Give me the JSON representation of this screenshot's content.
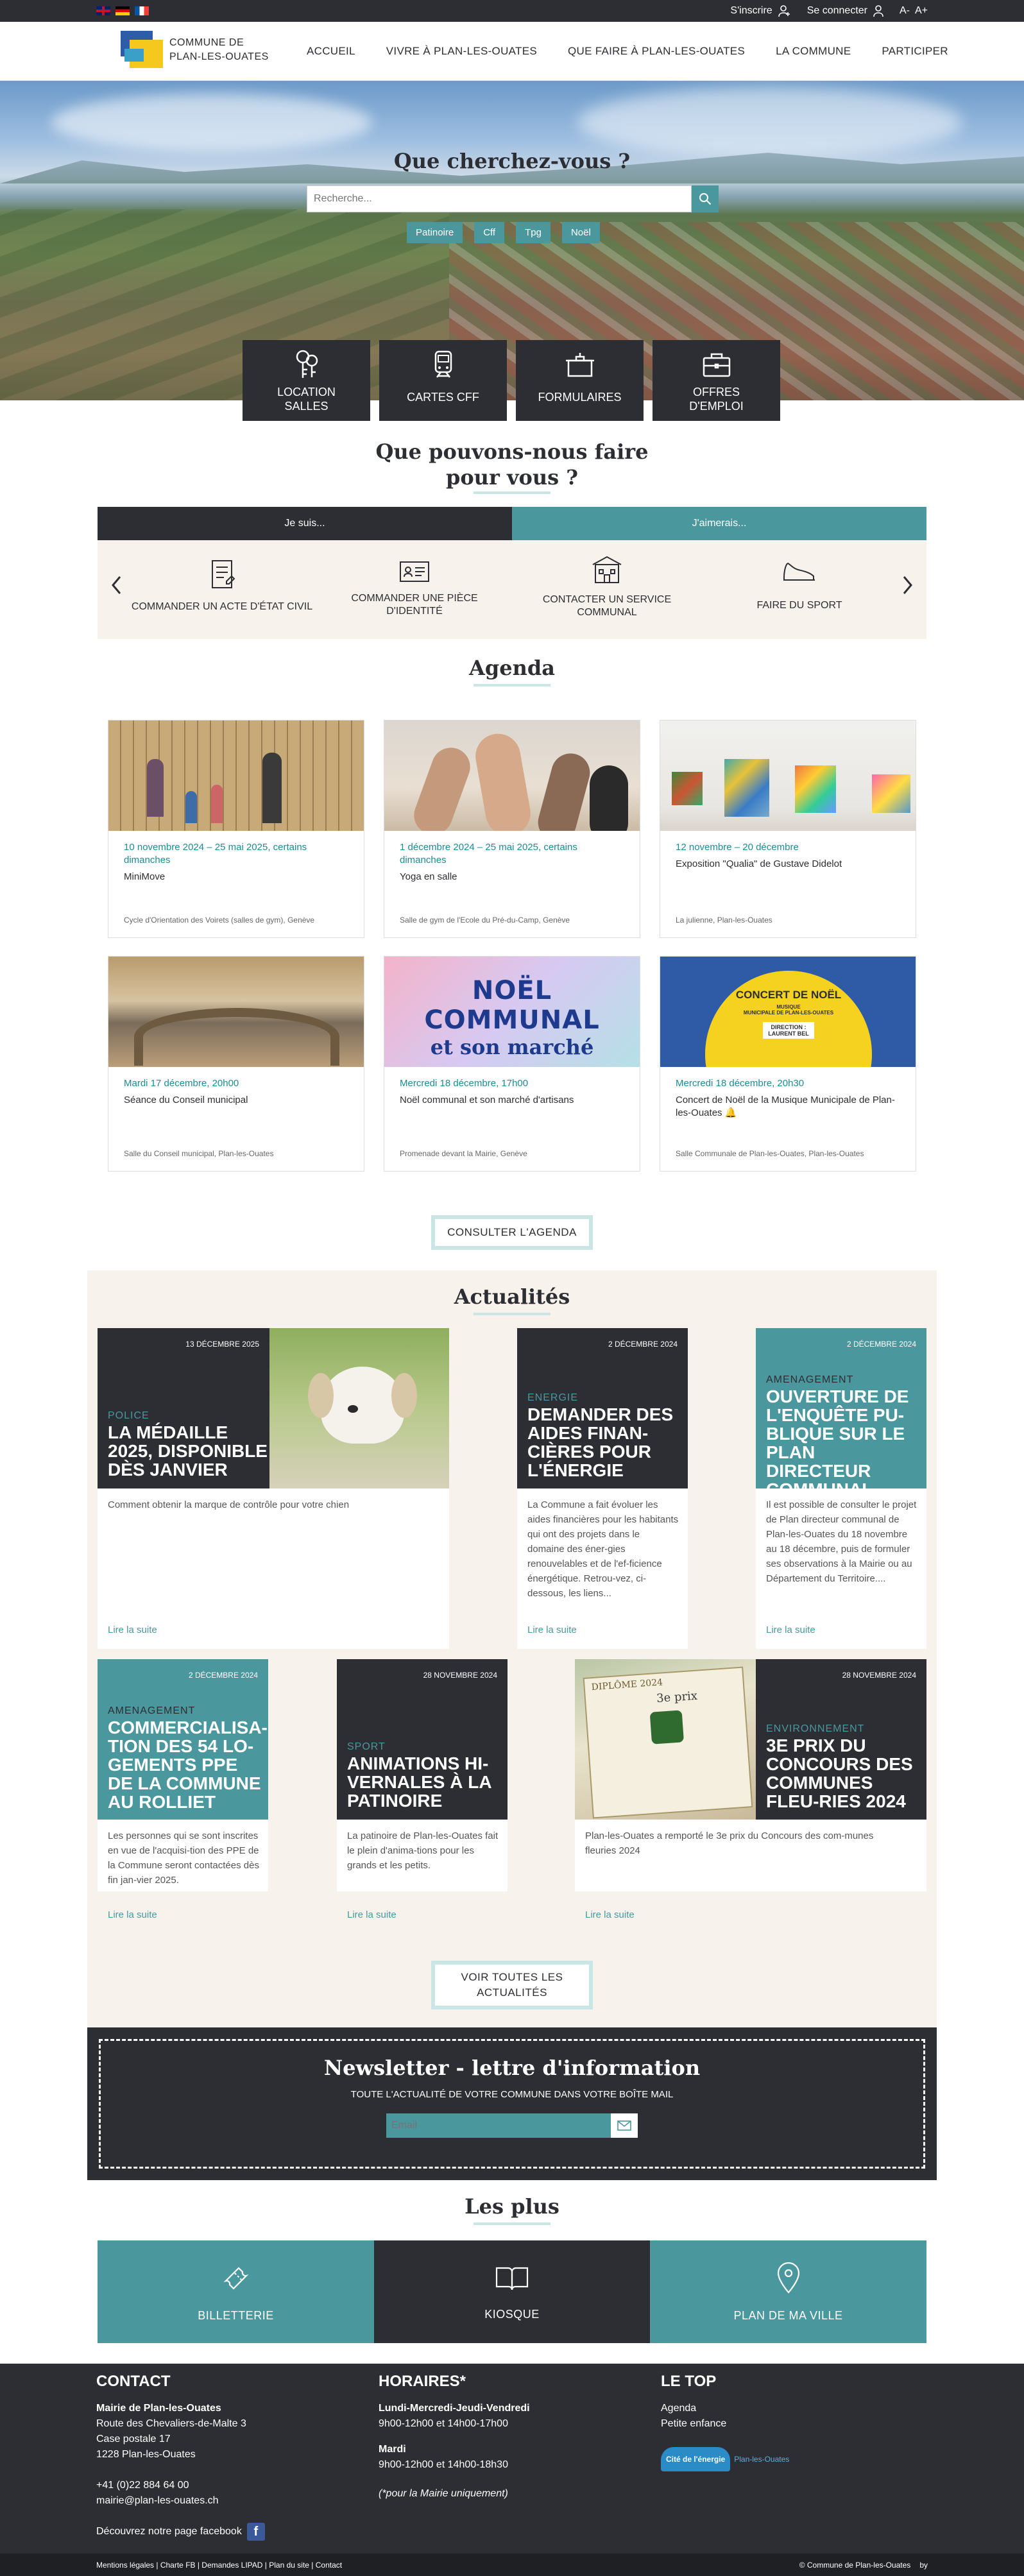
{
  "topbar": {
    "languages": [
      "en",
      "de",
      "fr"
    ],
    "register": "S'inscrire",
    "login": "Se connecter",
    "font_smaller": "A-",
    "font_larger": "A+"
  },
  "header": {
    "logo_line1": "COMMUNE DE",
    "logo_line2": "PLAN-LES-OUATES",
    "nav": [
      "ACCUEIL",
      "VIVRE À PLAN-LES-OUATES",
      "QUE FAIRE À PLAN-LES-OUATES",
      "LA COMMUNE",
      "PARTICIPER"
    ]
  },
  "hero": {
    "title": "Que cherchez-vous ?",
    "search_placeholder": "Recherche...",
    "tags": [
      "Patinoire",
      "Cff",
      "Tpg",
      "Noël"
    ]
  },
  "quick_links": [
    {
      "label": "LOCATION SALLES",
      "icon": "keys-icon"
    },
    {
      "label": "CARTES CFF",
      "icon": "train-icon"
    },
    {
      "label": "FORMULAIRES",
      "icon": "briefcase-form-icon"
    },
    {
      "label": "OFFRES D'EMPLOI",
      "icon": "briefcase-icon"
    }
  ],
  "services": {
    "title_line1": "Que pouvons-nous faire",
    "title_line2": "pour vous ?",
    "tab_left": "Je suis...",
    "tab_right": "J'aimerais...",
    "items": [
      {
        "label": "COMMANDER UN ACTE D'ÉTAT CIVIL",
        "icon": "document-icon"
      },
      {
        "label": "COMMANDER UNE PIÈCE D'IDENTITÉ",
        "icon": "id-card-icon"
      },
      {
        "label": "CONTACTER UN SERVICE COMMUNAL",
        "icon": "building-icon"
      },
      {
        "label": "FAIRE DU SPORT",
        "icon": "sneaker-icon"
      }
    ]
  },
  "agenda": {
    "title": "Agenda",
    "button": "CONSULTER L'AGENDA",
    "events": [
      {
        "date": "10 novembre 2024 – 25 mai 2025, certains dimanches",
        "title": "MiniMove",
        "place": "Cycle d'Orientation des Voirets (salles de gym), Genève"
      },
      {
        "date": "1 décembre 2024 – 25 mai 2025, certains dimanches",
        "title": "Yoga en salle",
        "place": "Salle de gym de l'Ecole du Pré-du-Camp, Genève"
      },
      {
        "date": "12 novembre – 20 décembre",
        "title": "Exposition \"Qualia\" de Gustave Didelot",
        "place": "La julienne, Plan-les-Ouates"
      },
      {
        "date": "Mardi 17 décembre, 20h00",
        "title": "Séance du Conseil municipal",
        "place": "Salle du Conseil municipal, Plan-les-Ouates"
      },
      {
        "date": "Mercredi 18 décembre, 17h00",
        "title": "Noël communal et son marché d'artisans",
        "place": "Promenade devant la Mairie, Genève"
      },
      {
        "date": "Mercredi 18 décembre, 20h30",
        "title": "Concert de Noël de la Musique Municipale de Plan-les-Ouates 🔔",
        "place": "Salle Communale de Plan-les-Ouates, Plan-les-Ouates"
      }
    ],
    "poster_noel_line1": "NOËL COMMUNAL",
    "poster_noel_line2": "et son marché",
    "poster_concert_line1": "CONCERT DE NOËL",
    "poster_concert_line2": "MUSIQUE",
    "poster_concert_line3": "MUNICIPALE DE PLAN-LES-OUATES",
    "poster_concert_line4": "DIRECTION :",
    "poster_concert_line5": "LAURENT BEL"
  },
  "news": {
    "title": "Actualités",
    "button_line1": "VOIR TOUTES LES",
    "button_line2": "ACTUALITÉS",
    "read_more": "Lire la suite",
    "items": [
      {
        "date": "13 DÉCEMBRE 2025",
        "category": "POLICE",
        "title": "LA MÉDAILLE 2025, DISPONIBLE DÈS JANVIER",
        "body": "Comment obtenir la marque de contrôle pour votre chien"
      },
      {
        "date": "2 DÉCEMBRE 2024",
        "category": "ENERGIE",
        "title": "DEMANDER DES AIDES FINAN-CIÈRES POUR L'ÉNERGIE",
        "body": "La Commune a fait évoluer les aides financières pour les habitants qui ont des projets dans le domaine des éner-gies renouvelables et de l'ef-ficience énergétique. Retrou-vez, ci-dessous, les liens..."
      },
      {
        "date": "2 DÉCEMBRE 2024",
        "category": "AMENAGEMENT",
        "title": "OUVERTURE DE L'ENQUÊTE PU-BLIQUE SUR LE PLAN DIRECTEUR COMMUNAL",
        "body": "Il est possible de consulter le projet de Plan directeur communal de Plan-les-Ouates du 18 novembre au 18 décembre, puis de formuler ses observations à la Mairie ou au Département du Territoire...."
      },
      {
        "date": "2 DÉCEMBRE 2024",
        "category": "AMENAGEMENT",
        "title": "COMMERCIALISA-TION DES 54 LO-GEMENTS PPE DE LA COMMUNE AU ROLLIET",
        "body": "Les personnes qui se sont inscrites en vue de l'acquisi-tion des PPE de la Commune seront contactées dès fin jan-vier 2025."
      },
      {
        "date": "28 NOVEMBRE 2024",
        "category": "SPORT",
        "title": "ANIMATIONS HI-VERNALES À LA PATINOIRE",
        "body": "La patinoire de Plan-les-Ouates fait le plein d'anima-tions pour les grands et les petits."
      },
      {
        "date": "28 NOVEMBRE 2024",
        "category": "ENVIRONNEMENT",
        "title": "3E PRIX DU CONCOURS DES COMMUNES FLEU-RIES 2024",
        "body": "Plan-les-Ouates a remporté le 3e prix du Concours des com-munes fleuries 2024"
      }
    ],
    "diploma_title": "DIPLÔME 2024",
    "diploma_prize": "3e prix"
  },
  "newsletter": {
    "title": "Newsletter - lettre d'information",
    "subtitle": "TOUTE L'ACTUALITÉ DE VOTRE COMMUNE DANS VOTRE BOÎTE MAIL",
    "placeholder": "Email"
  },
  "les_plus": {
    "title": "Les plus",
    "items": [
      {
        "label": "BILLETTERIE",
        "icon": "ticket-icon"
      },
      {
        "label": "KIOSQUE",
        "icon": "book-icon"
      },
      {
        "label": "PLAN DE MA VILLE",
        "icon": "map-pin-icon"
      }
    ]
  },
  "footer": {
    "contact_title": "CONTACT",
    "contact_name": "Mairie de Plan-les-Ouates",
    "contact_lines": [
      "Route des Chevaliers-de-Malte 3",
      "Case postale 17",
      "1228 Plan-les-Ouates"
    ],
    "phone": "+41 (0)22 884 64 00",
    "email": "mairie@plan-les-ouates.ch",
    "facebook": "Découvrez notre page facebook",
    "hours_title": "HORAIRES*",
    "hours_day1": "Lundi-Mercredi-Jeudi-Vendredi",
    "hours_time1": "9h00-12h00 et 14h00-17h00",
    "hours_day2": "Mardi",
    "hours_time2": "9h00-12h00 et 14h00-18h30",
    "hours_note": "(*pour la Mairie uniquement)",
    "top_title": "LE TOP",
    "top_links": [
      "Agenda",
      "Petite enfance"
    ],
    "energy_label": "Cité de l'énergie",
    "energy_sub": "Plan-les-Ouates"
  },
  "bottom": {
    "links": "Mentions légales | Charte FB | Demandes LIPAD | Plan du site | Contact",
    "copyright": "© Commune de Plan-les-Ouates",
    "by": "by"
  }
}
